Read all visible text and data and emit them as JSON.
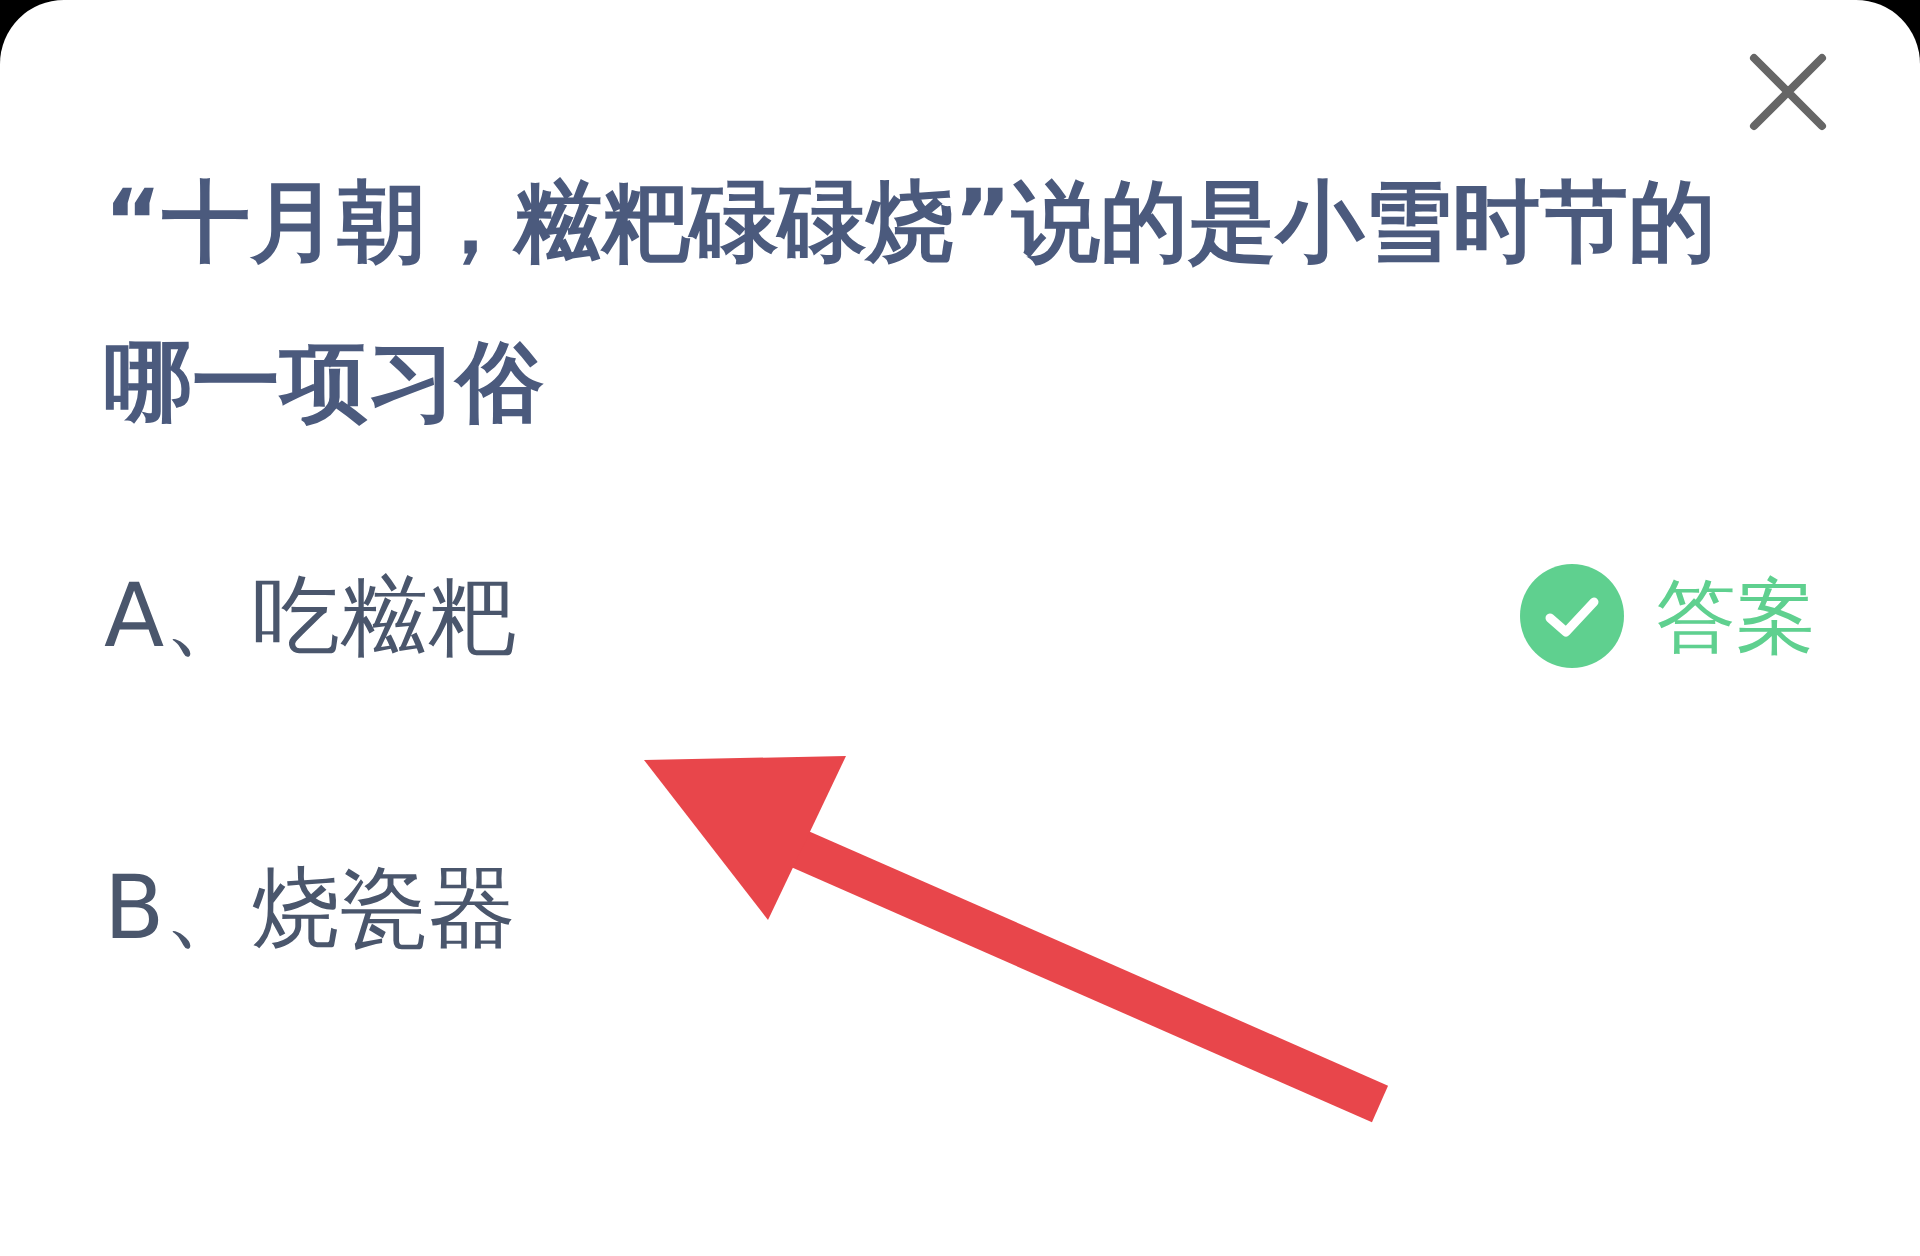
{
  "question": "“十月朝，糍粑碌碌烧”说的是小雪时节的哪一项习俗",
  "options": [
    {
      "label": "A、吃糍粑",
      "correct": true,
      "answer_label": "答案"
    },
    {
      "label": "B、烧瓷器",
      "correct": false
    }
  ]
}
